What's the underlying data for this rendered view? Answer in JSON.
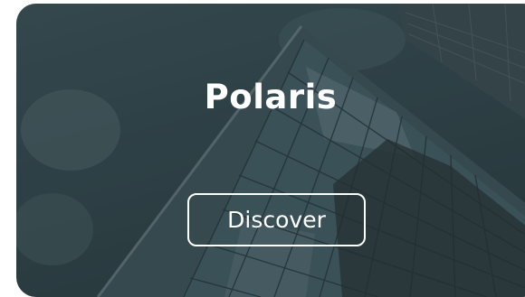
{
  "card": {
    "title": "Polaris",
    "button_label": "Discover",
    "background_image": "skyscraper-looking-up-photo"
  },
  "colors": {
    "overlay_tint": "#2f4347",
    "text": "#ffffff",
    "button_border": "#ffffff"
  }
}
